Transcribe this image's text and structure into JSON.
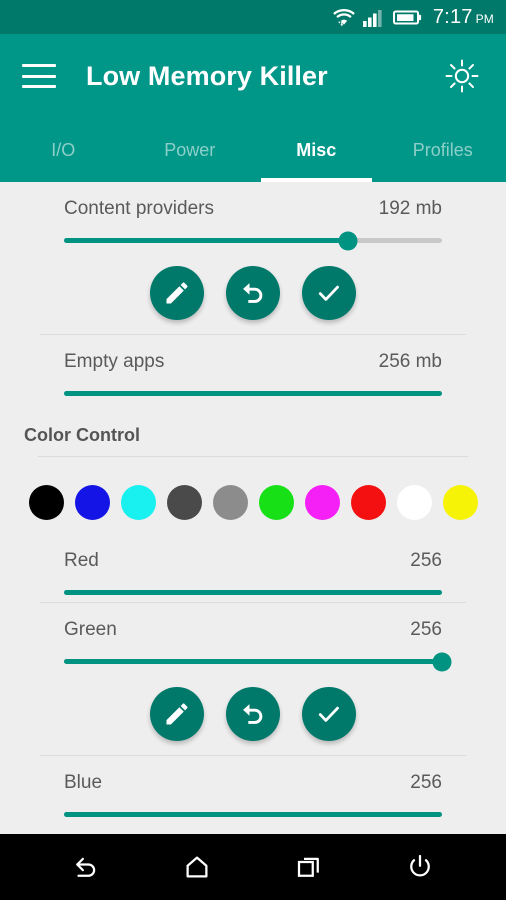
{
  "statusbar": {
    "time": "7:17",
    "ampm": "PM",
    "icons": [
      "wifi-icon",
      "signal-icon",
      "battery-icon"
    ]
  },
  "appbar": {
    "menu_icon": "hamburger-menu-icon",
    "title": "Low Memory Killer",
    "action_icon": "brightness-sun-icon"
  },
  "tabs": [
    {
      "label": "I/O",
      "active": false
    },
    {
      "label": "Power",
      "active": false
    },
    {
      "label": "Misc",
      "active": true
    },
    {
      "label": "Profiles",
      "active": false
    }
  ],
  "main": {
    "settings": [
      {
        "label": "Content providers",
        "value": "192 mb",
        "percent": 75
      },
      {
        "label": "Empty apps",
        "value": "256 mb",
        "percent": 100
      }
    ],
    "actions": [
      {
        "icon": "pencil-edit-icon",
        "name": "edit-button"
      },
      {
        "icon": "undo-arrow-icon",
        "name": "undo-button"
      },
      {
        "icon": "check-confirm-icon",
        "name": "apply-button"
      }
    ],
    "color_control": {
      "title": "Color Control",
      "swatches": [
        {
          "name": "black",
          "hex": "#000000"
        },
        {
          "name": "blue",
          "hex": "#1414e6"
        },
        {
          "name": "cyan",
          "hex": "#19f0f0"
        },
        {
          "name": "dark-gray",
          "hex": "#4a4a4a"
        },
        {
          "name": "gray",
          "hex": "#8c8c8c"
        },
        {
          "name": "green",
          "hex": "#17e017"
        },
        {
          "name": "magenta",
          "hex": "#f520f5"
        },
        {
          "name": "red",
          "hex": "#f41010"
        },
        {
          "name": "white",
          "hex": "#ffffff"
        },
        {
          "name": "yellow",
          "hex": "#f7f307"
        }
      ],
      "channels": [
        {
          "label": "Red",
          "value": "256",
          "percent": 100
        },
        {
          "label": "Green",
          "value": "256",
          "percent": 100
        },
        {
          "label": "Blue",
          "value": "256",
          "percent": 100
        }
      ]
    }
  },
  "navbar": [
    {
      "name": "back-button",
      "icon": "back-arrow-icon"
    },
    {
      "name": "home-button",
      "icon": "home-icon"
    },
    {
      "name": "recents-button",
      "icon": "recents-icon"
    },
    {
      "name": "power-button",
      "icon": "power-icon"
    }
  ],
  "colors": {
    "status_bar": "#00786a",
    "app_bar": "#009688",
    "accent": "#009382",
    "fab": "#00796b"
  }
}
